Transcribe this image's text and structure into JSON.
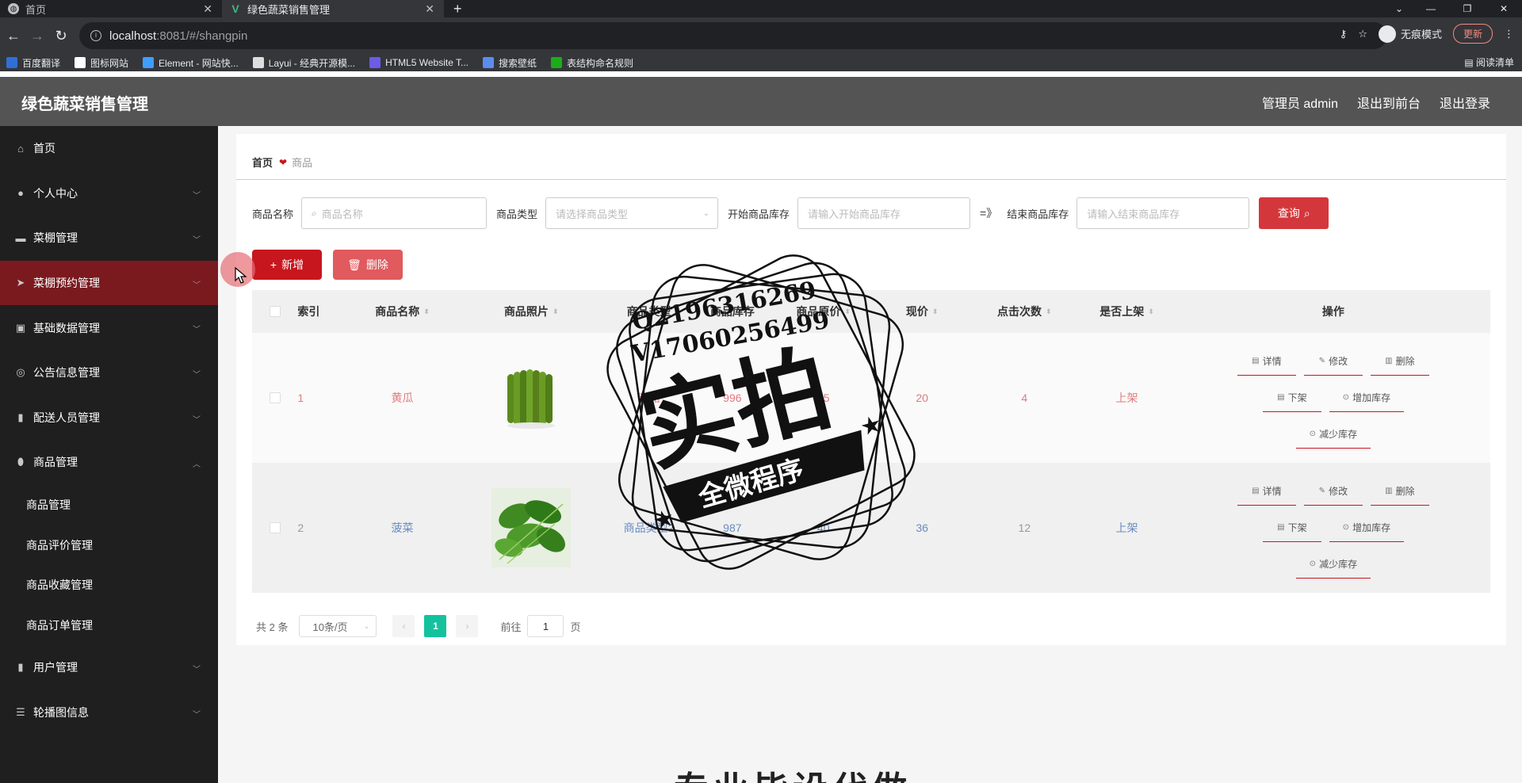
{
  "browser": {
    "tabs": [
      {
        "label": "首页",
        "active": false
      },
      {
        "label": "绿色蔬菜销售管理",
        "active": true
      }
    ],
    "url_host": "localhost",
    "url_path": ":8081/#/shangpin",
    "incognito_label": "无痕模式",
    "update_label": "更新",
    "bookmarks": [
      {
        "label": "百度翻译",
        "color": "#2f6fd6"
      },
      {
        "label": "图标网站",
        "color": "#ffffff"
      },
      {
        "label": "Element - 网站快...",
        "color": "#409eff"
      },
      {
        "label": "Layui - 经典开源模...",
        "color": "#dddddd"
      },
      {
        "label": "HTML5 Website T...",
        "color": "#6c5ce7"
      },
      {
        "label": "搜索壁纸",
        "color": "#5b8def"
      },
      {
        "label": "表结构命名规则",
        "color": "#1aad19"
      }
    ],
    "reading_list_label": "阅读清单"
  },
  "header": {
    "title": "绿色蔬菜销售管理",
    "admin_label": "管理员 admin",
    "frontend_label": "退出到前台",
    "logout_label": "退出登录"
  },
  "sidebar": {
    "items": [
      {
        "label": "首页",
        "icon": "home-icon",
        "chevron": false
      },
      {
        "label": "个人中心",
        "icon": "user-icon",
        "chevron": true
      },
      {
        "label": "菜棚管理",
        "icon": "chat-icon",
        "chevron": true
      },
      {
        "label": "菜棚预约管理",
        "icon": "send-icon",
        "chevron": true,
        "active": true
      },
      {
        "label": "基础数据管理",
        "icon": "clipboard-icon",
        "chevron": true
      },
      {
        "label": "公告信息管理",
        "icon": "globe-icon",
        "chevron": true
      },
      {
        "label": "配送人员管理",
        "icon": "bar-chart-icon",
        "chevron": true
      },
      {
        "label": "商品管理",
        "icon": "location-icon",
        "chevron": true,
        "expanded": true
      }
    ],
    "subitems": [
      "商品管理",
      "商品评价管理",
      "商品收藏管理",
      "商品订单管理"
    ],
    "items_after": [
      {
        "label": "用户管理",
        "icon": "bar-chart-icon",
        "chevron": true
      },
      {
        "label": "轮播图信息",
        "icon": "sliders-icon",
        "chevron": true
      }
    ]
  },
  "breadcrumb": {
    "home": "首页",
    "current": "商品"
  },
  "search": {
    "name_label": "商品名称",
    "name_placeholder": "商品名称",
    "type_label": "商品类型",
    "type_placeholder": "请选择商品类型",
    "start_stock_label": "开始商品库存",
    "start_stock_placeholder": "请输入开始商品库存",
    "arrow": "=》",
    "end_stock_label": "结束商品库存",
    "end_stock_placeholder": "请输入结束商品库存",
    "query_label": "查询"
  },
  "actions": {
    "add_label": "新增",
    "delete_label": "删除"
  },
  "table": {
    "headers": {
      "index": "索引",
      "name": "商品名称",
      "photo": "商品照片",
      "type": "商品类型",
      "stock": "商品库存",
      "orig_price": "商品原价",
      "price": "现价",
      "clicks": "点击次数",
      "shelf": "是否上架",
      "ops": "操作"
    },
    "rows": [
      {
        "index": "1",
        "name": "黄瓜",
        "type": "商品",
        "stock": "996",
        "orig_price": "35",
        "price": "20",
        "clicks": "4",
        "shelf": "上架",
        "image": "cucumber"
      },
      {
        "index": "2",
        "name": "菠菜",
        "type": "商品类型2",
        "stock": "987",
        "orig_price": "40",
        "price": "36",
        "clicks": "12",
        "shelf": "上架",
        "image": "spinach"
      }
    ],
    "ops": {
      "detail": "详情",
      "edit": "修改",
      "delete": "删除",
      "offshelf": "下架",
      "add_stock": "增加库存",
      "reduce_stock": "减少库存"
    }
  },
  "pager": {
    "total": "共 2 条",
    "page_size": "10条/页",
    "current_page": "1",
    "goto_label": "前往",
    "goto_value": "1",
    "page_suffix": "页"
  },
  "watermark": {
    "line1": "Q2196316269",
    "line2": "V17060256499",
    "big_text": "实拍",
    "ribbon": "全微程序"
  },
  "bottom_caption": "专业毕设代做"
}
